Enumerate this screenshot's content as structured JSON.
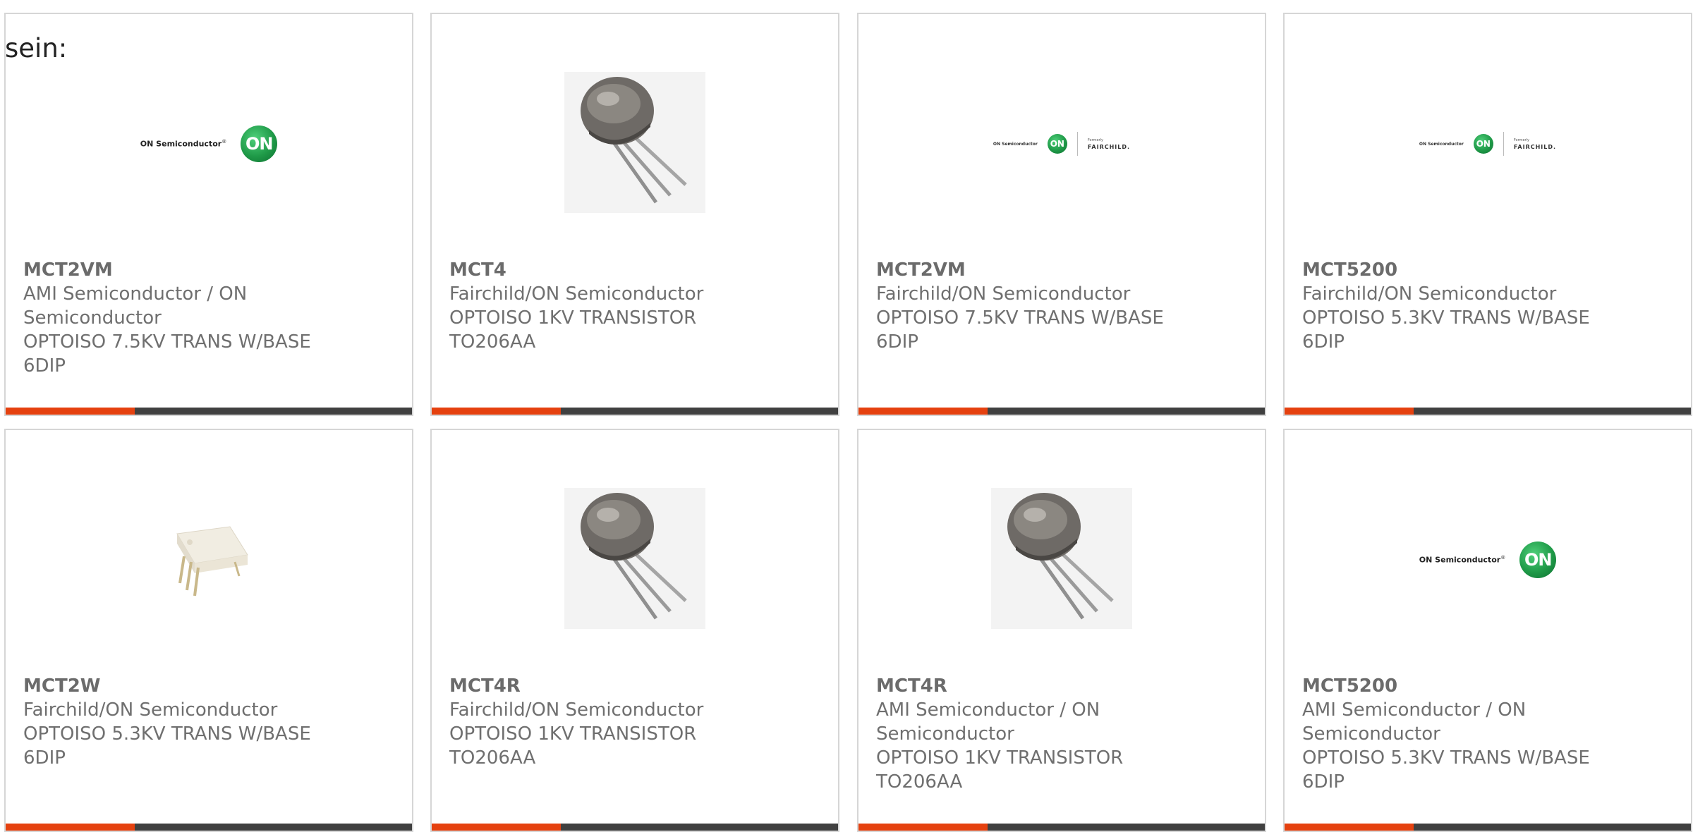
{
  "intro_text": "sein:",
  "logos": {
    "on_text": "ON Semiconductor",
    "on_mark": "ON",
    "fairchild_formerly": "Formerly",
    "fairchild_name": "FAIRCHILD."
  },
  "products": [
    {
      "part": "MCT2VM",
      "mfr_lines": [
        "AMI Semiconductor / ON",
        "Semiconductor"
      ],
      "desc_lines": [
        "OPTOISO 7.5KV TRANS W/BASE",
        "6DIP"
      ],
      "image": "on-semiconductor-logo"
    },
    {
      "part": "MCT4",
      "mfr_lines": [
        "Fairchild/ON Semiconductor"
      ],
      "desc_lines": [
        "OPTOISO 1KV TRANSISTOR",
        "TO206AA"
      ],
      "image": "to206-can-photo"
    },
    {
      "part": "MCT2VM",
      "mfr_lines": [
        "Fairchild/ON Semiconductor"
      ],
      "desc_lines": [
        "OPTOISO 7.5KV TRANS W/BASE",
        "6DIP"
      ],
      "image": "on-fairchild-logo"
    },
    {
      "part": "MCT5200",
      "mfr_lines": [
        "Fairchild/ON Semiconductor"
      ],
      "desc_lines": [
        "OPTOISO 5.3KV TRANS W/BASE",
        "6DIP"
      ],
      "image": "on-fairchild-logo"
    },
    {
      "part": "MCT2W",
      "mfr_lines": [
        "Fairchild/ON Semiconductor"
      ],
      "desc_lines": [
        "OPTOISO 5.3KV TRANS W/BASE",
        "6DIP"
      ],
      "image": "dip6-package-photo"
    },
    {
      "part": "MCT4R",
      "mfr_lines": [
        "Fairchild/ON Semiconductor"
      ],
      "desc_lines": [
        "OPTOISO 1KV TRANSISTOR",
        "TO206AA"
      ],
      "image": "to206-can-photo"
    },
    {
      "part": "MCT4R",
      "mfr_lines": [
        "AMI Semiconductor / ON",
        "Semiconductor"
      ],
      "desc_lines": [
        "OPTOISO 1KV TRANSISTOR",
        "TO206AA"
      ],
      "image": "to206-can-photo"
    },
    {
      "part": "MCT5200",
      "mfr_lines": [
        "AMI Semiconductor / ON",
        "Semiconductor"
      ],
      "desc_lines": [
        "OPTOISO 5.3KV TRANS W/BASE",
        "6DIP"
      ],
      "image": "on-semiconductor-logo"
    }
  ],
  "colors": {
    "accent": "#e5410f",
    "bar": "#404040",
    "border": "#d6d6d6",
    "text": "#6f6f6f"
  }
}
